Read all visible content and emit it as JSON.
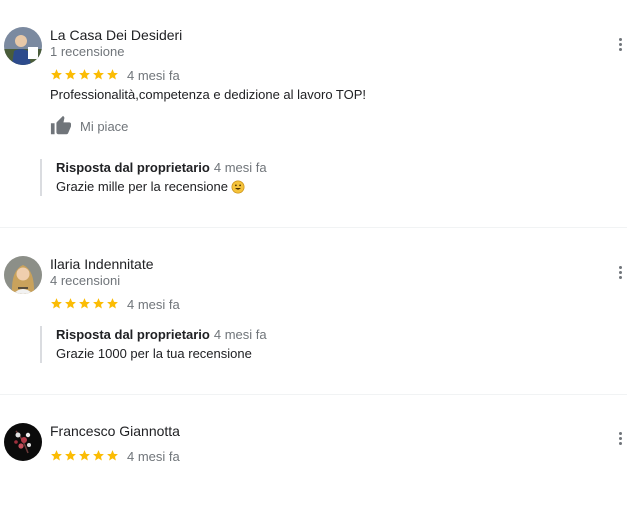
{
  "reviews": [
    {
      "author": "La Casa Dei Desideri",
      "review_count": "1 recensione",
      "rating": 5,
      "date": "4 mesi fa",
      "text": "Professionalità,competenza e dedizione al lavoro TOP!",
      "like_label": "Mi piace",
      "reply": {
        "title": "Risposta dal proprietario",
        "date": "4 mesi fa",
        "text": "Grazie mille per la recensione"
      },
      "avatar": "avatar-person-photo"
    },
    {
      "author": "Ilaria Indennitate",
      "review_count": "4 recensioni",
      "rating": 5,
      "date": "4 mesi fa",
      "reply": {
        "title": "Risposta dal proprietario",
        "date": "4 mesi fa",
        "text": "Grazie 1000 per la tua recensione"
      },
      "avatar": "avatar-woman-photo"
    },
    {
      "author": "Francesco Giannotta",
      "rating": 5,
      "date": "4 mesi fa",
      "avatar": "avatar-floral-photo"
    }
  ],
  "colors": {
    "star": "#fbbc04",
    "secondary_text": "#70757a",
    "primary_text": "#202124",
    "reply_border": "#dadce0"
  },
  "icons": {
    "like": "thumbs-up-icon",
    "menu": "more-vert-icon",
    "emoji": "smiling-face-emoji"
  }
}
